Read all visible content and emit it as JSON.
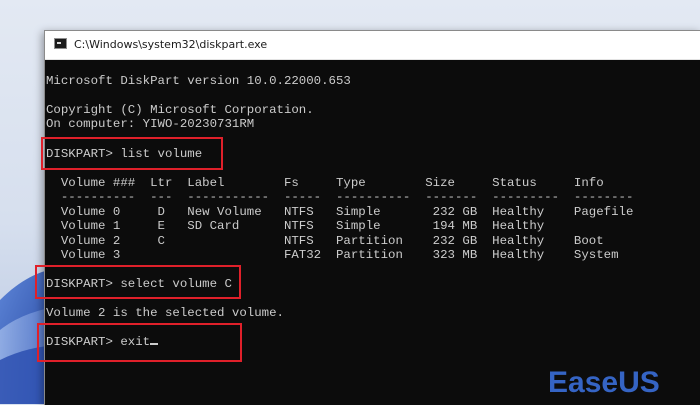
{
  "window": {
    "title": "C:\\Windows\\system32\\diskpart.exe",
    "icon": "console-icon"
  },
  "console": {
    "lines": [
      "Microsoft DiskPart version 10.0.22000.653",
      "",
      "Copyright (C) Microsoft Corporation.",
      "On computer: YIWO-20230731RM",
      "",
      "DISKPART> list volume",
      "",
      "  Volume ###  Ltr  Label        Fs     Type        Size     Status     Info",
      "  ----------  ---  -----------  -----  ----------  -------  ---------  --------",
      "  Volume 0     D   New Volume   NTFS   Simple       232 GB  Healthy    Pagefile",
      "  Volume 1     E   SD Card      NTFS   Simple       194 MB  Healthy",
      "  Volume 2     C                NTFS   Partition    232 GB  Healthy    Boot",
      "  Volume 3                      FAT32  Partition    323 MB  Healthy    System",
      "",
      "DISKPART> select volume C",
      "",
      "Volume 2 is the selected volume.",
      "",
      "DISKPART> exit"
    ]
  },
  "watermark": {
    "text": "EaseUS",
    "color": "#3a6ed8"
  },
  "colors": {
    "console_bg": "#0c0c0c",
    "console_fg": "#cccccc",
    "highlight": "#e0202a"
  }
}
